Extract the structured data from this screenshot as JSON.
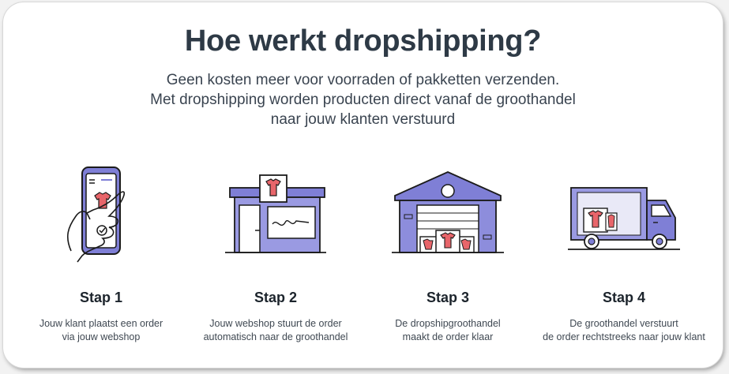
{
  "header": {
    "title": "Hoe werkt dropshipping?",
    "subtitle_lines": [
      "Geen kosten meer voor voorraden of pakketten verzenden.",
      "Met dropshipping worden producten direct vanaf de groothandel",
      "naar jouw klanten verstuurd"
    ]
  },
  "colors": {
    "accent_purple": "#7f7fd6",
    "shirt_red": "#e8656a",
    "text_dark": "#2e3a46"
  },
  "steps": [
    {
      "icon": "phone-order-icon",
      "title": "Stap 1",
      "desc": [
        "Jouw klant plaatst een order",
        "via jouw webshop"
      ]
    },
    {
      "icon": "webshop-store-icon",
      "title": "Stap 2",
      "desc": [
        "Jouw webshop stuurt de order",
        "automatisch naar de groothandel"
      ]
    },
    {
      "icon": "warehouse-icon",
      "title": "Stap 3",
      "desc": [
        "De dropshipgroothandel",
        "maakt de order klaar"
      ]
    },
    {
      "icon": "delivery-truck-icon",
      "title": "Stap 4",
      "desc": [
        "De groothandel verstuurt",
        "de order rechtstreeks naar jouw klant"
      ]
    }
  ]
}
